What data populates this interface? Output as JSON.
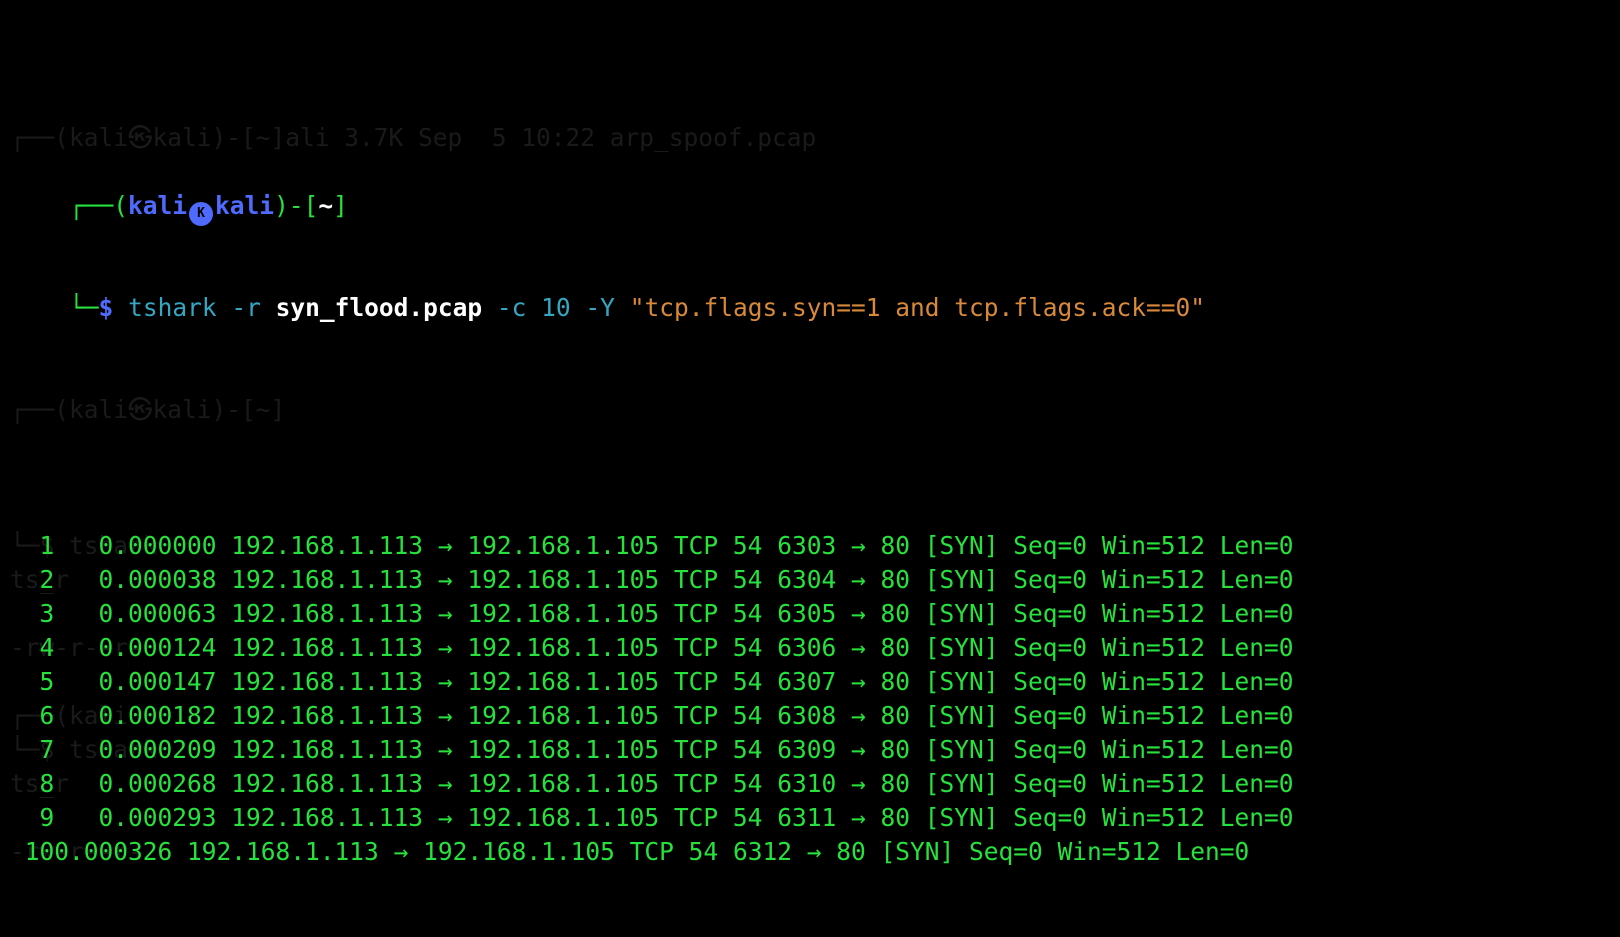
{
  "prompt": {
    "box_top": "┌──(",
    "user": "kali",
    "host_icon": "kali-skull-icon",
    "host_icon_glyph": "K",
    "host": "kali",
    "close_paren": ")-[",
    "dir": "~",
    "close_bracket": "]",
    "box_bottom": "└─",
    "dollar": "$"
  },
  "command": {
    "program": "tshark",
    "flag_r": "-r",
    "file": "syn_flood.pcap",
    "flag_c": "-c 10 -Y",
    "filter": "\"tcp.flags.syn==1 and tcp.flags.ack==0\""
  },
  "ghost_lines": [
    "┌──(kali㉿kali)-[~]ali 3.7K Sep  5 10:22 arp_spoof.pcap",
    "",
    "┌──(kali㉿kali)-[~]",
    "└─$ tshark",
    "ts_r",
    "",
    "-rw-r--r-",
    "",
    "┌──(kali",
    "└─$ tshark",
    "ts_r",
    "",
    "-rw-r--r-"
  ],
  "packets": [
    {
      "no": "1",
      "time": "0.000000",
      "src": "192.168.1.113",
      "dst": "192.168.1.105",
      "proto": "TCP",
      "len": "54",
      "sport": "6303",
      "dport": "80",
      "info": "[SYN] Seq=0 Win=512 Len=0"
    },
    {
      "no": "2",
      "time": "0.000038",
      "src": "192.168.1.113",
      "dst": "192.168.1.105",
      "proto": "TCP",
      "len": "54",
      "sport": "6304",
      "dport": "80",
      "info": "[SYN] Seq=0 Win=512 Len=0"
    },
    {
      "no": "3",
      "time": "0.000063",
      "src": "192.168.1.113",
      "dst": "192.168.1.105",
      "proto": "TCP",
      "len": "54",
      "sport": "6305",
      "dport": "80",
      "info": "[SYN] Seq=0 Win=512 Len=0"
    },
    {
      "no": "4",
      "time": "0.000124",
      "src": "192.168.1.113",
      "dst": "192.168.1.105",
      "proto": "TCP",
      "len": "54",
      "sport": "6306",
      "dport": "80",
      "info": "[SYN] Seq=0 Win=512 Len=0"
    },
    {
      "no": "5",
      "time": "0.000147",
      "src": "192.168.1.113",
      "dst": "192.168.1.105",
      "proto": "TCP",
      "len": "54",
      "sport": "6307",
      "dport": "80",
      "info": "[SYN] Seq=0 Win=512 Len=0"
    },
    {
      "no": "6",
      "time": "0.000182",
      "src": "192.168.1.113",
      "dst": "192.168.1.105",
      "proto": "TCP",
      "len": "54",
      "sport": "6308",
      "dport": "80",
      "info": "[SYN] Seq=0 Win=512 Len=0"
    },
    {
      "no": "7",
      "time": "0.000209",
      "src": "192.168.1.113",
      "dst": "192.168.1.105",
      "proto": "TCP",
      "len": "54",
      "sport": "6309",
      "dport": "80",
      "info": "[SYN] Seq=0 Win=512 Len=0"
    },
    {
      "no": "8",
      "time": "0.000268",
      "src": "192.168.1.113",
      "dst": "192.168.1.105",
      "proto": "TCP",
      "len": "54",
      "sport": "6310",
      "dport": "80",
      "info": "[SYN] Seq=0 Win=512 Len=0"
    },
    {
      "no": "9",
      "time": "0.000293",
      "src": "192.168.1.113",
      "dst": "192.168.1.105",
      "proto": "TCP",
      "len": "54",
      "sport": "6311",
      "dport": "80",
      "info": "[SYN] Seq=0 Win=512 Len=0"
    },
    {
      "no": "10",
      "time": "0.000326",
      "src": "192.168.1.113",
      "dst": "192.168.1.105",
      "proto": "TCP",
      "len": "54",
      "sport": "6312",
      "dport": "80",
      "info": "[SYN] Seq=0 Win=512 Len=0"
    }
  ],
  "arrow": "→",
  "colors": {
    "background": "#000000",
    "prompt_blue": "#4f6bff",
    "output_green": "#27e23d",
    "command_cyan": "#34a7c3",
    "filter_orange": "#d9893a"
  }
}
